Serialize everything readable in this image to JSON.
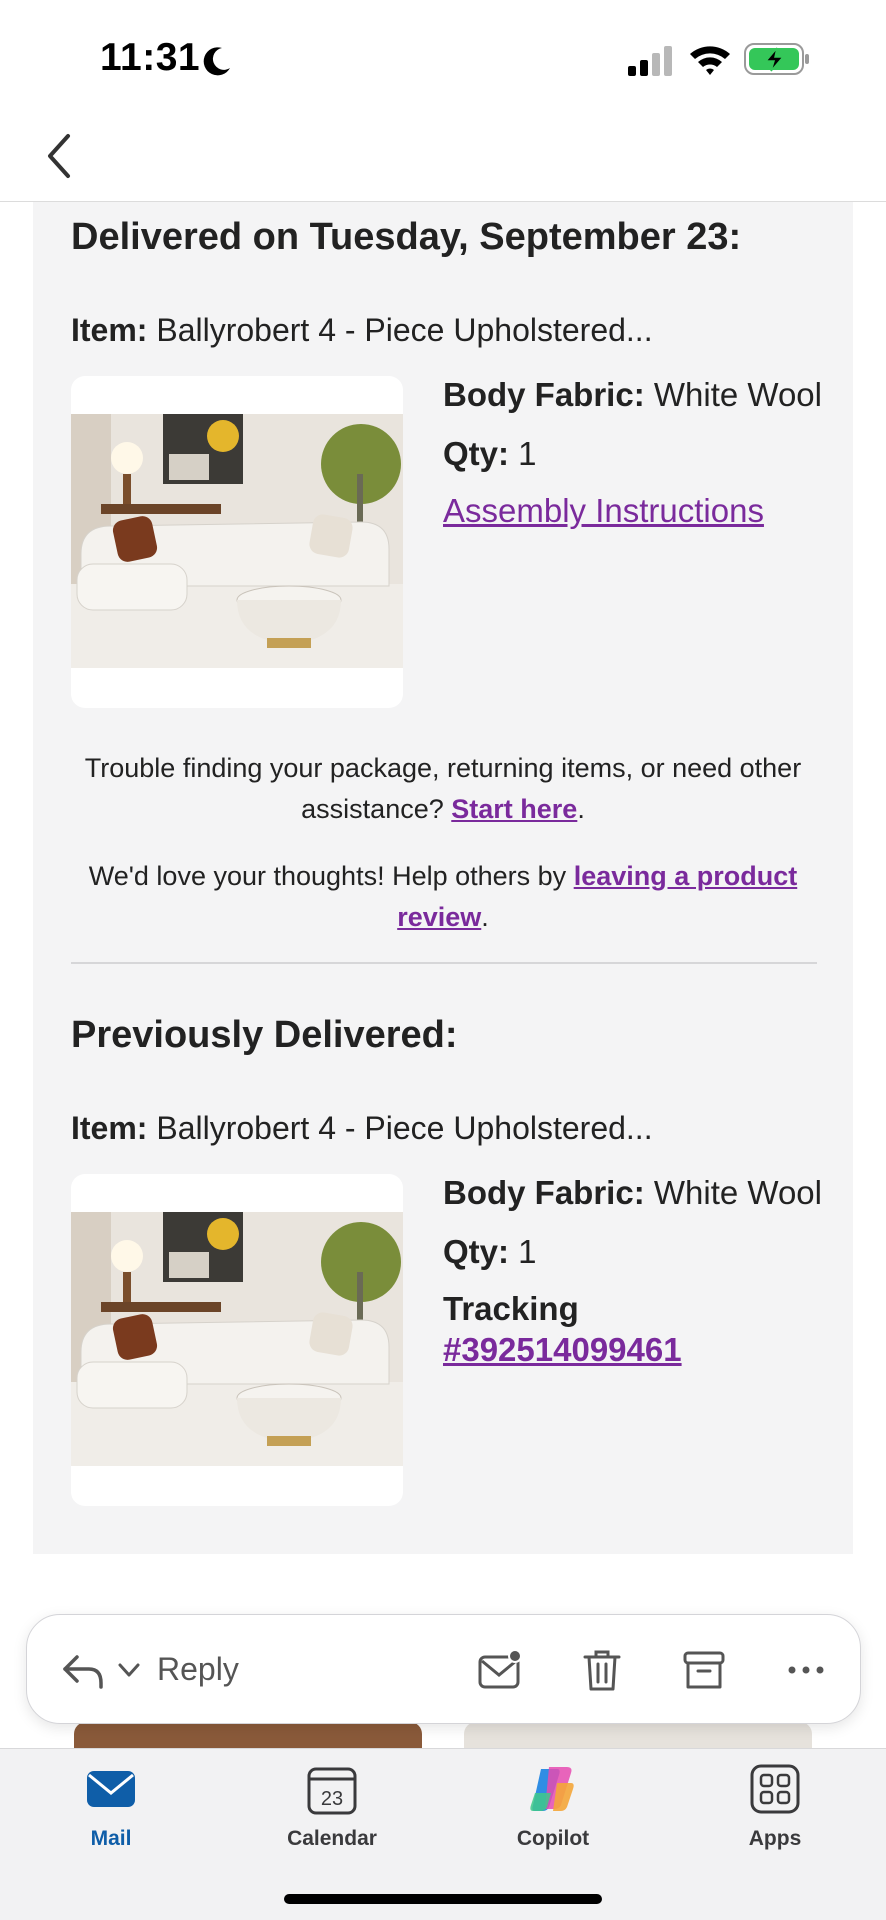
{
  "status": {
    "time": "11:31"
  },
  "delivered": {
    "title": "Delivered on Tuesday, September 23:",
    "item_label": "Item:",
    "item_name": "Ballyrobert 4 - Piece Upholstered...",
    "fabric_label": "Body Fabric:",
    "fabric_value": "White Wool",
    "qty_label": "Qty:",
    "qty_value": "1",
    "assembly_link": "Assembly Instructions"
  },
  "help": {
    "text1": "Trouble finding your package, returning items, or need other assistance?",
    "link1": "Start here",
    "period1": ".",
    "text2": "We'd love your thoughts! Help others by",
    "link2": "leaving a product review",
    "period2": "."
  },
  "previous": {
    "title": "Previously Delivered:",
    "item_label": "Item:",
    "item_name": "Ballyrobert 4 - Piece Upholstered...",
    "fabric_label": "Body Fabric:",
    "fabric_value": "White Wool",
    "qty_label": "Qty:",
    "qty_value": "1",
    "tracking_label": "Tracking",
    "tracking_number": "#392514099461"
  },
  "toolbar": {
    "reply_label": "Reply",
    "icons": [
      "reply-icon",
      "chevron-down-icon",
      "mark-unread-icon",
      "trash-icon",
      "archive-icon",
      "more-icon"
    ]
  },
  "tabs": [
    {
      "label": "Mail",
      "icon": "mail-icon",
      "active": true
    },
    {
      "label": "Calendar",
      "icon": "calendar-icon",
      "calendar_day": "23",
      "active": false
    },
    {
      "label": "Copilot",
      "icon": "copilot-icon",
      "active": false
    },
    {
      "label": "Apps",
      "icon": "apps-icon",
      "active": false
    }
  ],
  "colors": {
    "link": "#7a2a9c",
    "mail_active": "#0f5ea8",
    "card_bg": "#f4f4f5",
    "battery_green": "#34c759"
  }
}
